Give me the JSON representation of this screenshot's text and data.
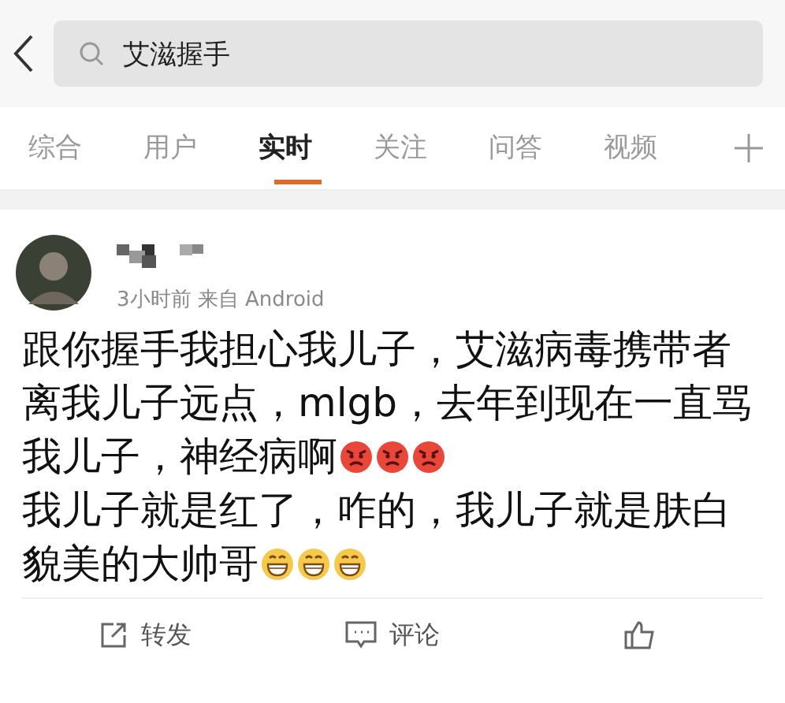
{
  "search": {
    "value": "艾滋握手"
  },
  "tabs": [
    {
      "label": "综合",
      "selected": false
    },
    {
      "label": "用户",
      "selected": false
    },
    {
      "label": "实时",
      "selected": true
    },
    {
      "label": "关注",
      "selected": false
    },
    {
      "label": "问答",
      "selected": false
    },
    {
      "label": "视频",
      "selected": false
    }
  ],
  "post": {
    "meta": "3小时前  来自 Android",
    "paragraphs": [
      {
        "text": "跟你握手我担心我儿子，艾滋病毒携带者离我儿子远点，mlgb，去年到现在一直骂我儿子，神经病啊",
        "emojis": [
          {
            "kind": "angry"
          },
          {
            "kind": "angry"
          },
          {
            "kind": "angry"
          }
        ]
      },
      {
        "text": "我儿子就是红了，咋的，我儿子就是肤白貌美的大帅哥",
        "emojis": [
          {
            "kind": "grin"
          },
          {
            "kind": "grin"
          },
          {
            "kind": "grin"
          }
        ]
      }
    ]
  },
  "actions": [
    {
      "kind": "repost",
      "label": "转发"
    },
    {
      "kind": "comment",
      "label": "评论"
    },
    {
      "kind": "like"
    }
  ]
}
